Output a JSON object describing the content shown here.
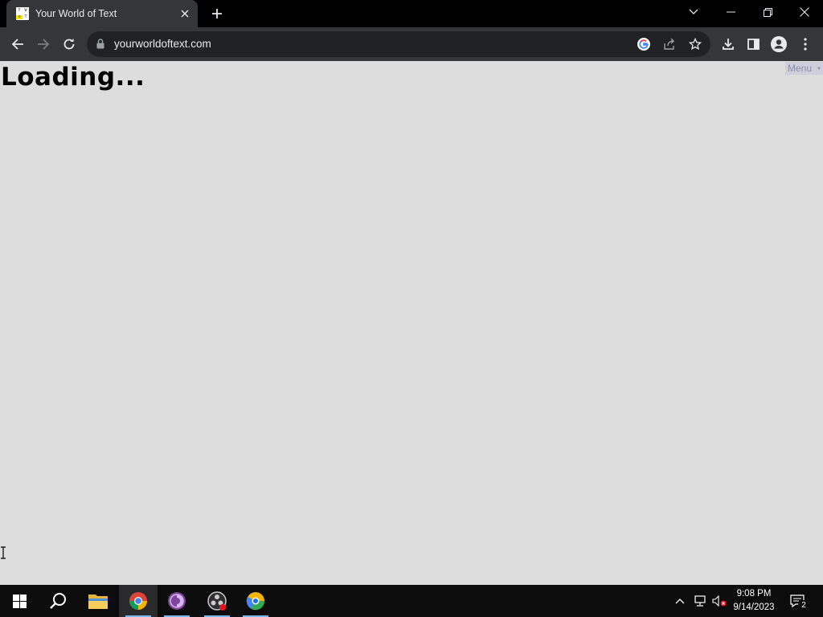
{
  "browser": {
    "tab": {
      "title": "Your World of Text",
      "favicon_letters": [
        "Y",
        "W",
        "o",
        "T"
      ]
    },
    "address": {
      "url": "yourworldoftext.com"
    },
    "icons": {
      "back": "arrow-left-icon",
      "forward": "arrow-right-icon",
      "reload": "reload-icon",
      "lock": "lock-icon",
      "google": "google-icon",
      "share": "share-icon",
      "bookmark": "star-icon",
      "download": "download-icon",
      "side_panel": "side-panel-icon",
      "profile": "profile-icon",
      "menu": "kebab-menu-icon"
    }
  },
  "page": {
    "loading_text": "Loading...",
    "menu_label": "Menu",
    "menu_caret": "▼"
  },
  "taskbar": {
    "clock_time": "9:08 PM",
    "clock_date": "9/14/2023",
    "notification_count": "2",
    "apps": [
      "start-icon",
      "search-icon",
      "file-explorer-icon",
      "chrome-icon",
      "tor-browser-icon",
      "obs-icon",
      "other-browser-icon"
    ]
  },
  "colors": {
    "tab_bg": "#35363a",
    "page_bg": "#dddddd",
    "taskbar_bg": "#0c0c0d",
    "menu_bg": "#cfcfdc"
  }
}
